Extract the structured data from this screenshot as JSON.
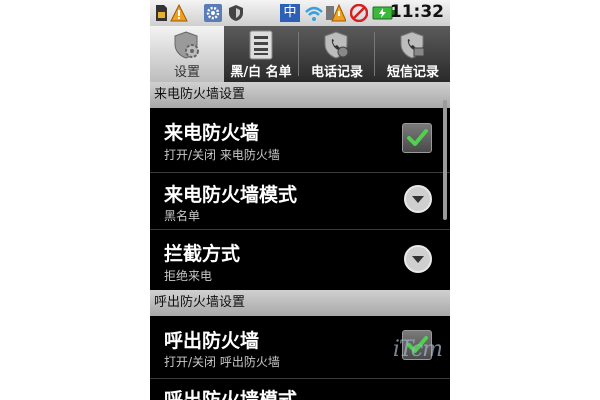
{
  "statusbar": {
    "clock": "11:32",
    "ime": "中",
    "icons": [
      "sim-card-icon",
      "warning-icon",
      "settings-icon",
      "shield-icon",
      "wifi-icon",
      "warning-icon",
      "no-entry-icon",
      "battery-icon"
    ]
  },
  "tabs": [
    {
      "label": "设置",
      "icon": "shield-gear-icon",
      "active": true
    },
    {
      "label": "黑/白 名单",
      "icon": "list-icon",
      "active": false
    },
    {
      "label": "电话记录",
      "icon": "shield-phone-icon",
      "active": false
    },
    {
      "label": "短信记录",
      "icon": "shield-sms-icon",
      "active": false
    }
  ],
  "sections": [
    {
      "header": "来电防火墙设置",
      "items": [
        {
          "title": "来电防火墙",
          "subtitle": "打开/关闭 来电防火墙",
          "control": "checkbox",
          "checked": true
        },
        {
          "title": "来电防火墙模式",
          "subtitle": "黑名单",
          "control": "dropdown"
        },
        {
          "title": "拦截方式",
          "subtitle": "拒绝来电",
          "control": "dropdown"
        }
      ]
    },
    {
      "header": "呼出防火墙设置",
      "items": [
        {
          "title": "呼出防火墙",
          "subtitle": "打开/关闭 呼出防火墙",
          "control": "checkbox",
          "checked": true
        },
        {
          "title": "呼出防火墙模式",
          "subtitle": "",
          "control": "dropdown"
        }
      ]
    }
  ],
  "watermark": "iTcm",
  "colors": {
    "check": "#4dd24d",
    "background": "#000000",
    "section": "#bdbdbd"
  }
}
